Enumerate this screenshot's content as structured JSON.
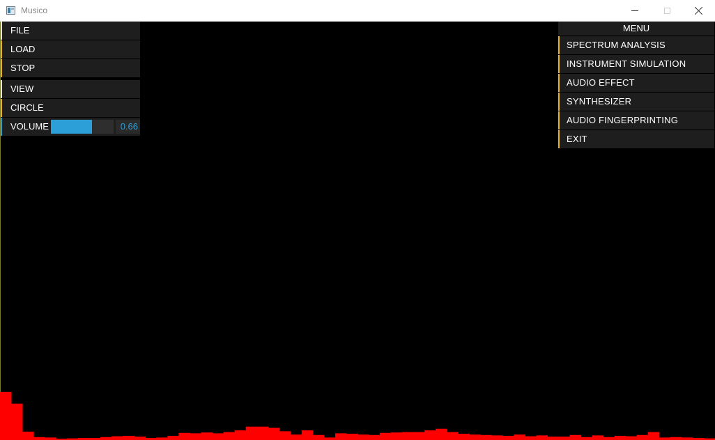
{
  "window": {
    "title": "Musico"
  },
  "left_panel": {
    "items": [
      {
        "label": "FILE"
      },
      {
        "label": "LOAD"
      },
      {
        "label": "STOP"
      },
      {
        "label": "VIEW"
      },
      {
        "label": "CIRCLE"
      }
    ],
    "volume": {
      "label": "VOLUME",
      "value": 0.66,
      "value_text": "0.66"
    }
  },
  "menu": {
    "title": "MENU",
    "items": [
      {
        "label": "SPECTRUM ANALYSIS"
      },
      {
        "label": "INSTRUMENT SIMULATION"
      },
      {
        "label": "AUDIO EFFECT"
      },
      {
        "label": "SYNTHESIZER"
      },
      {
        "label": "AUDIO FINGERPRINTING"
      },
      {
        "label": "EXIT"
      }
    ]
  },
  "colors": {
    "accent": "#e8b325",
    "volume_fill": "#2c9fd9",
    "spectrum": "#ff0000",
    "panel_bg": "#1e1e1e"
  },
  "icons": {
    "app": "app-window-icon",
    "minimize": "minimize-icon",
    "maximize": "maximize-icon",
    "close": "close-icon"
  },
  "spectrum": {
    "bar_count": 64,
    "levels": [
      0.115,
      0.087,
      0.02,
      0.007,
      0.006,
      0.003,
      0.004,
      0.005,
      0.005,
      0.007,
      0.009,
      0.01,
      0.008,
      0.005,
      0.006,
      0.01,
      0.017,
      0.016,
      0.018,
      0.016,
      0.019,
      0.023,
      0.032,
      0.032,
      0.029,
      0.021,
      0.013,
      0.023,
      0.012,
      0.006,
      0.016,
      0.015,
      0.013,
      0.012,
      0.017,
      0.018,
      0.019,
      0.019,
      0.023,
      0.027,
      0.019,
      0.015,
      0.013,
      0.012,
      0.011,
      0.01,
      0.013,
      0.009,
      0.011,
      0.008,
      0.008,
      0.012,
      0.007,
      0.011,
      0.007,
      0.01,
      0.009,
      0.012,
      0.019,
      0.006,
      0.007,
      0.006,
      0.005,
      0.004
    ]
  }
}
